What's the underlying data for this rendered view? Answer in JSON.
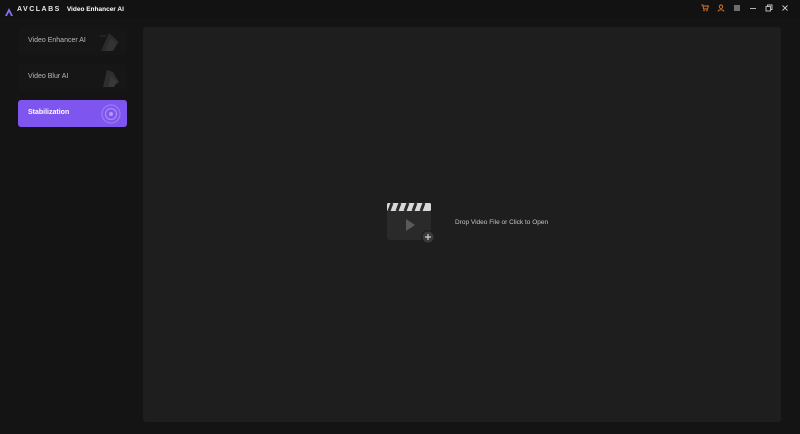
{
  "titlebar": {
    "brand": "AVCLABS",
    "app_name": "Video Enhancer AI",
    "icons": [
      "cart-icon",
      "user-icon",
      "menu-icon",
      "minimize-icon",
      "restore-icon",
      "close-icon"
    ],
    "accent_color": "#e07a2e"
  },
  "sidebar": {
    "items": [
      {
        "label": "Video Enhancer AI",
        "icon": "enhancer-art-icon",
        "active": false
      },
      {
        "label": "Video Blur AI",
        "icon": "blur-art-icon",
        "active": false
      },
      {
        "label": "Stabilization",
        "icon": "stabilization-art-icon",
        "active": true
      }
    ],
    "active_color": "#7f55f0"
  },
  "workspace": {
    "drop_text": "Drop Video File or Click to Open",
    "icon": "clapperboard-add-icon"
  }
}
